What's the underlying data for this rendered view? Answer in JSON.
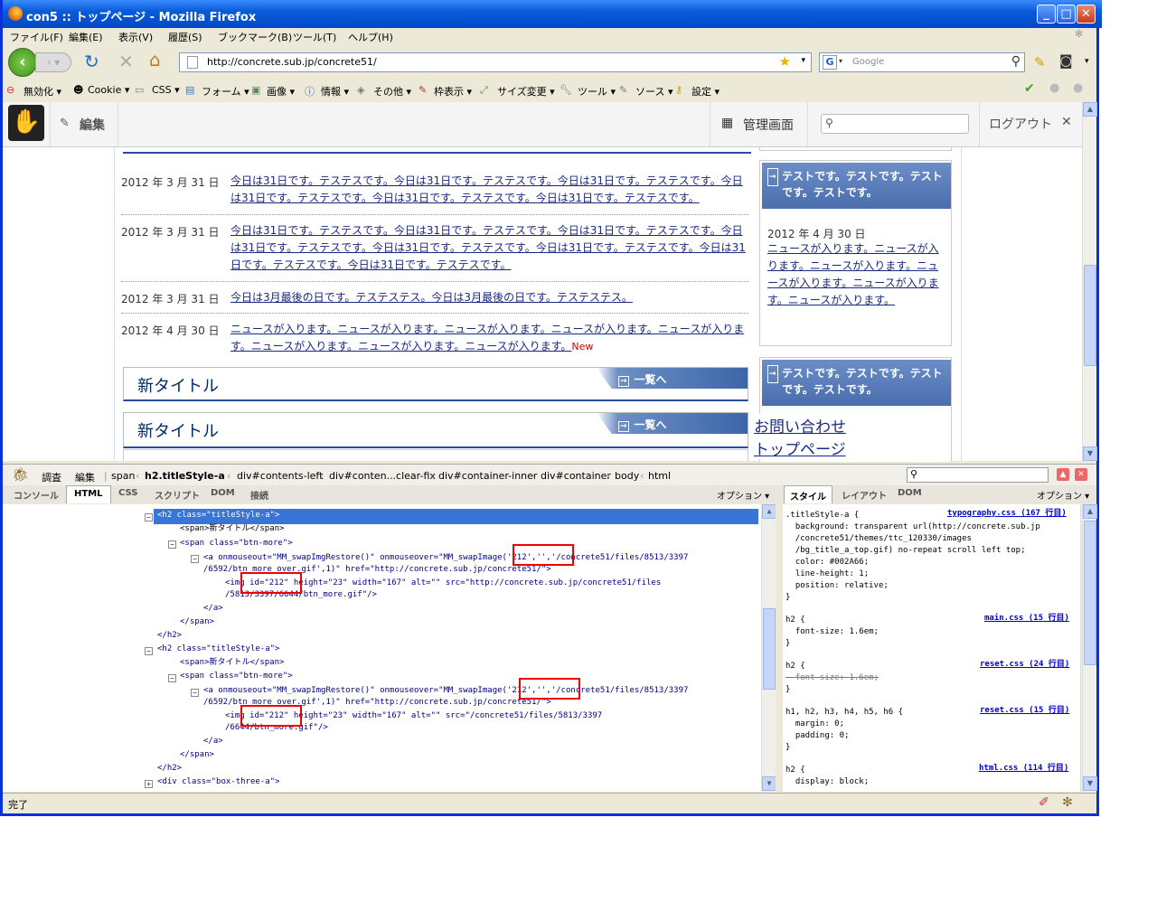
{
  "window": {
    "title": "con5 :: トップページ - Mozilla Firefox"
  },
  "menu": [
    "ファイル(F)",
    "編集(E)",
    "表示(V)",
    "履歴(S)",
    "ブックマーク(B)",
    "ツール(T)",
    "ヘルプ(H)"
  ],
  "nav": {
    "url": "http://concrete.sub.jp/concrete51/",
    "search_placeholder": "Google"
  },
  "devtoolbar": [
    "無効化 ▾",
    "Cookie ▾",
    "CSS ▾",
    "フォーム ▾",
    "画像 ▾",
    "情報 ▾",
    "その他 ▾",
    "枠表示 ▾",
    "サイズ変更 ▾",
    "ツール ▾",
    "ソース ▾",
    "設定 ▾"
  ],
  "c5bar": {
    "edit": "編集",
    "admin": "管理画面",
    "logout": "ログアウト"
  },
  "news": [
    {
      "date": "2012 年 3 月 31 日",
      "text": "今日は31日です。テステスです。今日は31日です。テステスです。今日は31日です。テステスです。今日は31日です。テステスです。今日は31日です。テステスです。今日は31日です。テステスです。"
    },
    {
      "date": "2012 年 3 月 31 日",
      "text": "今日は31日です。テステスです。今日は31日です。テステスです。今日は31日です。テステスです。今日は31日です。テステスです。今日は31日です。テステスです。今日は31日です。テステスです。今日は31日です。テステスです。今日は31日です。テステスです。"
    },
    {
      "date": "2012 年 3 月 31 日",
      "text": "今日は3月最後の日です。テステステス。今日は3月最後の日です。テステステス。"
    },
    {
      "date": "2012 年 4 月 30 日",
      "text": "ニュースが入ります。ニュースが入ります。ニュースが入ります。ニュースが入ります。ニュースが入ります。ニュースが入ります。ニュースが入ります。ニュースが入ります。",
      "badge": "New"
    }
  ],
  "boxes": [
    {
      "title": "新タイトル",
      "more": "一覧へ"
    },
    {
      "title": "新タイトル",
      "more": "一覧へ"
    }
  ],
  "side": {
    "head1": "テストです。テストです。テストです。テストです。",
    "date": "2012 年 4 月 30 日",
    "text": "ニュースが入ります。ニュースが入ります。ニュースが入ります。ニュースが入ります。ニュースが入ります。ニュースが入ります。",
    "head2": "テストです。テストです。テストです。テストです。",
    "link1": "お問い合わせ",
    "link2": "トップページ"
  },
  "firebug": {
    "inspect": "調査",
    "edit": "編集",
    "crumbs": [
      "span",
      "h2.titleStyle-a",
      "div#contents-left",
      "div#conten...clear-fix",
      "div#container-inner",
      "div#container",
      "body",
      "html"
    ],
    "tabs": [
      "コンソール",
      "HTML",
      "CSS",
      "スクリプト",
      "DOM",
      "接続"
    ],
    "options": "オプション ▾",
    "side_tabs": [
      "スタイル",
      "レイアウト",
      "DOM"
    ]
  },
  "html_lines": [
    "<h2 class=\"titleStyle-a\">",
    "<span>新タイトル</span>",
    "<span class=\"btn-more\">",
    "<a onmouseout=\"MM_swapImgRestore()\" onmouseover=\"MM_swapImage('212','','/concrete51/files/8513/3397",
    "/6592/btn_more_over.gif',1)\" href=\"http://concrete.sub.jp/concrete51/\">",
    "<img id=\"212\" height=\"23\" width=\"167\" alt=\"\" src=\"http://concrete.sub.jp/concrete51/files",
    "/5813/3397/6644/btn_more.gif\"/>",
    "</a>",
    "</span>",
    "</h2>",
    "<h2 class=\"titleStyle-a\">",
    "<span>新タイトル</span>",
    "<span class=\"btn-more\">",
    "<a onmouseout=\"MM_swapImgRestore()\" onmouseover=\"MM_swapImage('212','','/concrete51/files/8513/3397",
    "/6592/btn_more_over.gif',1)\" href=\"http://concrete.sub.jp/concrete51/\">",
    "<img id=\"212\" height=\"23\" width=\"167\" alt=\"\" src=\"/concrete51/files/5813/3397",
    "/6644/btn_more.gif\"/>",
    "</a>",
    "</span>",
    "</h2>",
    "<div class=\"box-three-a\">"
  ],
  "css_lines": [
    ".titleStyle-a {",
    "  background: transparent url(http://concrete.sub.jp",
    "  /concrete51/themes/ttc_120330/images",
    "  /bg_title_a_top.gif) no-repeat scroll left top;",
    "  color: #002A66;",
    "  line-height: 1;",
    "  position: relative;",
    "}",
    "h2 {",
    "  font-size: 1.6em;",
    "}",
    "h2 {",
    "  font-size: 1.6em;",
    "}",
    "h1, h2, h3, h4, h5, h6 {",
    "  margin: 0;",
    "  padding: 0;",
    "}",
    "h2 {",
    "  display: block;"
  ],
  "css_sources": [
    "typography.css (167 行目)",
    "main.css (15 行目)",
    "reset.css (24 行目)",
    "reset.css (15 行目)",
    "html.css (114 行目)"
  ],
  "status": "完了",
  "colors": {
    "title_blue": "#0a5bd8",
    "link": "#1a2a80",
    "select": "#3875d7",
    "red": "#e00000"
  }
}
